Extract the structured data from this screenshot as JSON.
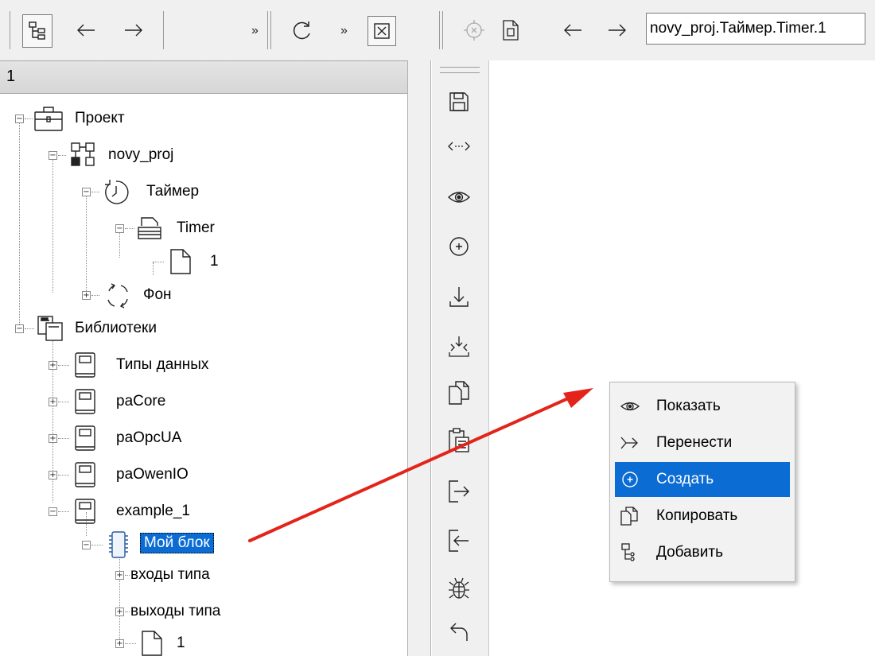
{
  "toolbar": {
    "overflow_label": "»",
    "path_value": "novy_proj.Таймер.Timer.1",
    "icons": [
      "tree-view-icon",
      "back-arrow-icon",
      "forward-arrow-icon",
      "refresh-icon",
      "close-box-icon",
      "target-icon",
      "document-icon",
      "back-arrow-icon",
      "forward-arrow-icon"
    ]
  },
  "tree": {
    "header": "1",
    "items": [
      {
        "label": "Проект",
        "icon": "project-briefcase-icon"
      },
      {
        "label": "novy_proj",
        "icon": "network-nodes-icon"
      },
      {
        "label": "Таймер",
        "icon": "timer-clock-icon"
      },
      {
        "label": "Timer",
        "icon": "stack-document-icon"
      },
      {
        "label": "1",
        "icon": "document-icon"
      },
      {
        "label": "Фон",
        "icon": "cycle-arrows-icon"
      },
      {
        "label": "Библиотеки",
        "icon": "libraries-icon"
      },
      {
        "label": "Типы данных",
        "icon": "book-icon"
      },
      {
        "label": "paCore",
        "icon": "book-icon"
      },
      {
        "label": "paOpcUA",
        "icon": "book-icon"
      },
      {
        "label": "paOwenIO",
        "icon": "book-icon"
      },
      {
        "label": "example_1",
        "icon": "book-icon"
      },
      {
        "label": "Мой блок",
        "icon": "chip-icon"
      },
      {
        "label": "входы типа",
        "icon": ""
      },
      {
        "label": "выходы типа",
        "icon": ""
      },
      {
        "label": "1",
        "icon": "document-icon"
      }
    ]
  },
  "vtoolbar": {
    "icons": [
      "save-icon",
      "swap-arrows-icon",
      "eye-icon",
      "add-circle-icon",
      "download-icon",
      "import-icon",
      "copy-icon",
      "paste-icon",
      "export-icon",
      "import-into-icon",
      "bug-icon",
      "undo-icon"
    ]
  },
  "context_menu": {
    "items": [
      {
        "label": "Показать",
        "icon": "eye-icon"
      },
      {
        "label": "Перенести",
        "icon": "move-arrow-icon"
      },
      {
        "label": "Создать",
        "icon": "add-circle-icon"
      },
      {
        "label": "Копировать",
        "icon": "copy-icon"
      },
      {
        "label": "Добавить",
        "icon": "add-node-icon"
      }
    ],
    "active_index": 2
  },
  "colors": {
    "selection": "#0b6cd4",
    "arrow": "#e3241b",
    "toolbar_bg": "#f0f0f0"
  }
}
